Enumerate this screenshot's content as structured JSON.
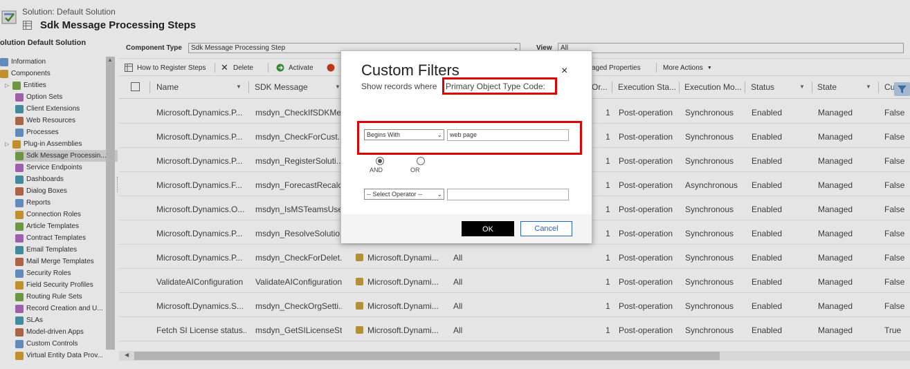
{
  "header": {
    "subtitle": "Solution: Default Solution",
    "title": "Sdk Message Processing Steps"
  },
  "sidebar": {
    "title": "olution Default Solution",
    "items": [
      {
        "label": "Information",
        "icon": "info-icon"
      },
      {
        "label": "Components",
        "icon": "components-icon"
      },
      {
        "label": "Entities",
        "icon": "entity-icon"
      },
      {
        "label": "Option Sets",
        "icon": "optionset-icon"
      },
      {
        "label": "Client Extensions",
        "icon": "extension-icon"
      },
      {
        "label": "Web Resources",
        "icon": "webresource-icon"
      },
      {
        "label": "Processes",
        "icon": "process-icon"
      },
      {
        "label": "Plug-in Assemblies",
        "icon": "plugin-icon"
      },
      {
        "label": "Sdk Message Processin...",
        "icon": "sdk-step-icon"
      },
      {
        "label": "Service Endpoints",
        "icon": "endpoint-icon"
      },
      {
        "label": "Dashboards",
        "icon": "dashboard-icon"
      },
      {
        "label": "Dialog Boxes",
        "icon": "dialog-icon"
      },
      {
        "label": "Reports",
        "icon": "report-icon"
      },
      {
        "label": "Connection Roles",
        "icon": "connection-icon"
      },
      {
        "label": "Article Templates",
        "icon": "article-icon"
      },
      {
        "label": "Contract Templates",
        "icon": "contract-icon"
      },
      {
        "label": "Email Templates",
        "icon": "email-icon"
      },
      {
        "label": "Mail Merge Templates",
        "icon": "mailmerge-icon"
      },
      {
        "label": "Security Roles",
        "icon": "security-icon"
      },
      {
        "label": "Field Security Profiles",
        "icon": "field-security-icon"
      },
      {
        "label": "Routing Rule Sets",
        "icon": "routing-icon"
      },
      {
        "label": "Record Creation and U...",
        "icon": "record-creation-icon"
      },
      {
        "label": "SLAs",
        "icon": "sla-icon"
      },
      {
        "label": "Model-driven Apps",
        "icon": "app-icon"
      },
      {
        "label": "Custom Controls",
        "icon": "control-icon"
      },
      {
        "label": "Virtual Entity Data Prov...",
        "icon": "virtual-entity-icon"
      }
    ]
  },
  "filterbar": {
    "component_type_label": "Component Type",
    "component_type_value": "Sdk Message Processing Step",
    "view_label": "View",
    "view_value": "All"
  },
  "toolbar": {
    "how_to": "How to Register Steps",
    "delete": "Delete",
    "activate": "Activate",
    "managed_properties": "aged Properties",
    "more_actions": "More Actions"
  },
  "grid": {
    "columns": {
      "name": "Name",
      "sdk_message": "SDK Message",
      "order": "Or...",
      "stage": "Execution Sta...",
      "mode": "Execution Mo...",
      "status": "Status",
      "state": "State",
      "cu": "Cu"
    },
    "rows": [
      {
        "name": "Microsoft.Dynamics.P...",
        "sdk": "msdyn_CheckIfSDKMe...",
        "event": "",
        "filter": "",
        "order": "1",
        "stage": "Post-operation",
        "mode": "Synchronous",
        "status": "Enabled",
        "state": "Managed",
        "cu": "False"
      },
      {
        "name": "Microsoft.Dynamics.P...",
        "sdk": "msdyn_CheckForCust...",
        "event": "",
        "filter": "",
        "order": "1",
        "stage": "Post-operation",
        "mode": "Synchronous",
        "status": "Enabled",
        "state": "Managed",
        "cu": "False"
      },
      {
        "name": "Microsoft.Dynamics.P...",
        "sdk": "msdyn_RegisterSoluti...",
        "event": "",
        "filter": "",
        "order": "1",
        "stage": "Post-operation",
        "mode": "Synchronous",
        "status": "Enabled",
        "state": "Managed",
        "cu": "False"
      },
      {
        "name": "Microsoft.Dynamics.F...",
        "sdk": "msdyn_ForecastRecalc...",
        "event": "",
        "filter": "",
        "order": "1",
        "stage": "Post-operation",
        "mode": "Asynchronous",
        "status": "Enabled",
        "state": "Managed",
        "cu": "False"
      },
      {
        "name": "Microsoft.Dynamics.O...",
        "sdk": "msdyn_IsMSTeamsUse...",
        "event": "",
        "filter": "",
        "order": "1",
        "stage": "Post-operation",
        "mode": "Synchronous",
        "status": "Enabled",
        "state": "Managed",
        "cu": "False"
      },
      {
        "name": "Microsoft.Dynamics.P...",
        "sdk": "msdyn_ResolveSolutio...",
        "event": "",
        "filter": "",
        "order": "1",
        "stage": "Post-operation",
        "mode": "Synchronous",
        "status": "Enabled",
        "state": "Managed",
        "cu": "False"
      },
      {
        "name": "Microsoft.Dynamics.P...",
        "sdk": "msdyn_CheckForDelet...",
        "event": "Microsoft.Dynami...",
        "filter": "All",
        "order": "1",
        "stage": "Post-operation",
        "mode": "Synchronous",
        "status": "Enabled",
        "state": "Managed",
        "cu": "False"
      },
      {
        "name": "ValidateAIConfiguration",
        "sdk": "ValidateAIConfiguration",
        "event": "Microsoft.Dynami...",
        "filter": "All",
        "order": "1",
        "stage": "Post-operation",
        "mode": "Synchronous",
        "status": "Enabled",
        "state": "Managed",
        "cu": "False"
      },
      {
        "name": "Microsoft.Dynamics.S...",
        "sdk": "msdyn_CheckOrgSetti...",
        "event": "Microsoft.Dynami...",
        "filter": "All",
        "order": "1",
        "stage": "Post-operation",
        "mode": "Synchronous",
        "status": "Enabled",
        "state": "Managed",
        "cu": "False"
      },
      {
        "name": "Fetch SI License status...",
        "sdk": "msdyn_GetSILicenseSt...",
        "event": "Microsoft.Dynami...",
        "filter": "All",
        "order": "1",
        "stage": "Post-operation",
        "mode": "Synchronous",
        "status": "Enabled",
        "state": "Managed",
        "cu": "True"
      }
    ]
  },
  "modal": {
    "title": "Custom Filters",
    "close": "×",
    "subtitle": "Show records where",
    "field": "Primary Object Type Code:",
    "operator1": "Begins With",
    "value1": "web page",
    "and_label": "AND",
    "or_label": "OR",
    "operator2": "-- Select Operator --",
    "value2": "",
    "ok": "OK",
    "cancel": "Cancel"
  },
  "colors": {
    "highlight": "#e00000",
    "ok_bg": "#000000",
    "cancel_border": "#2266c0",
    "filter_btn": "#b9cde8"
  }
}
